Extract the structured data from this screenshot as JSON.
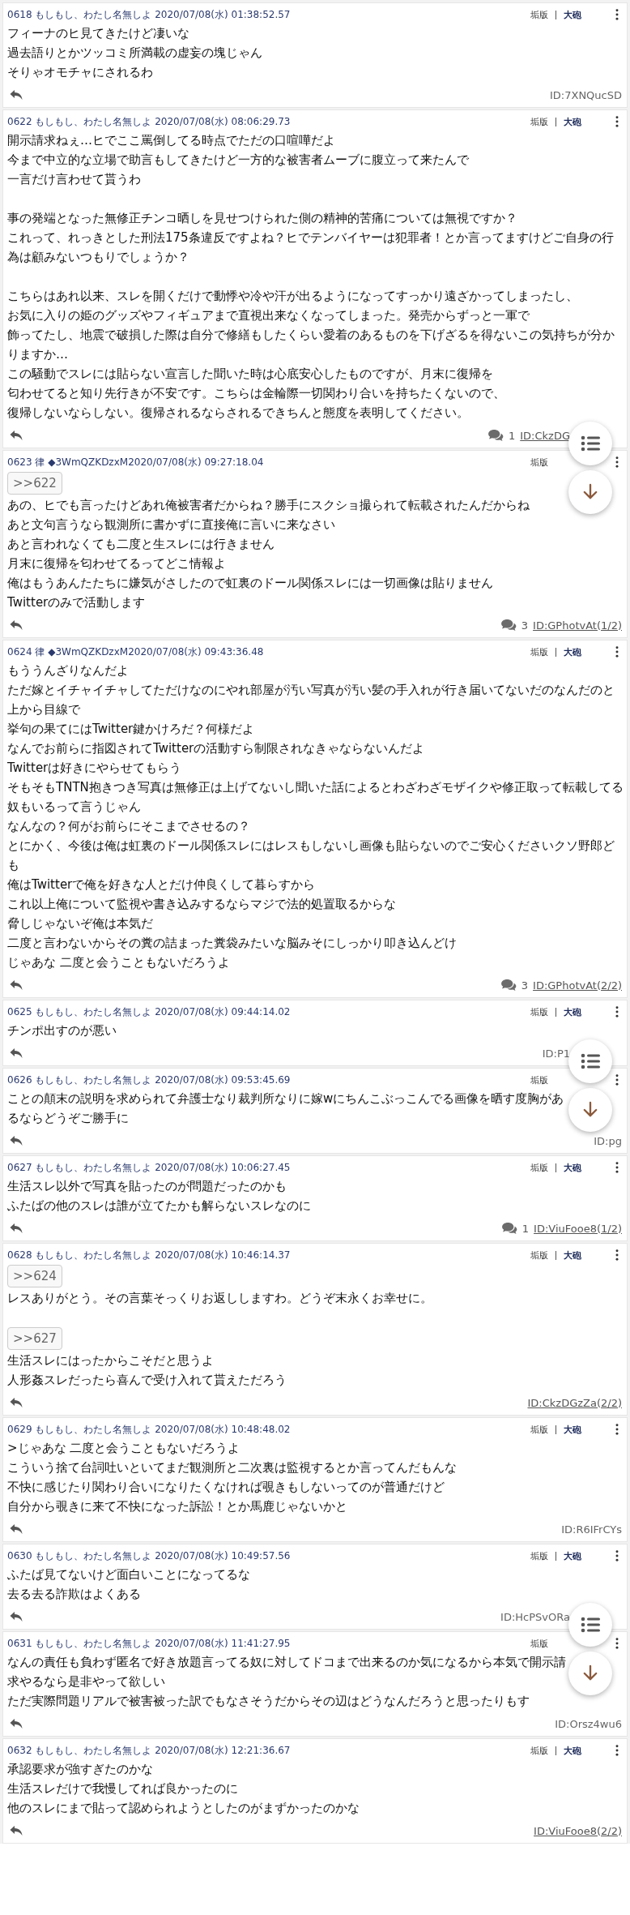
{
  "posts": [
    {
      "number": "0618",
      "name": "もしもし、わたし名無しよ",
      "date": "2020/07/08(水) 01:38:52.57",
      "actions": [
        "垢版",
        "大砲"
      ],
      "body": [
        {
          "kind": "text",
          "lines": [
            "フィーナのヒ見てきたけど凄いな",
            "過去語りとかツッコミ所満載の虚妄の塊じゃん",
            "そりゃオモチャにされるわ"
          ]
        }
      ],
      "id": "ID:7XNQucSD",
      "linked": false
    },
    {
      "number": "0622",
      "name": "もしもし、わたし名無しよ",
      "date": "2020/07/08(水) 08:06:29.73",
      "actions": [
        "垢版",
        "大砲"
      ],
      "body": [
        {
          "kind": "text",
          "lines": [
            "開示請求ねぇ…ヒでここ罵倒してる時点でただの口喧嘩だよ",
            "今まで中立的な立場で助言もしてきたけど一方的な被害者ムーブに腹立って来たんで",
            "一言だけ言わせて貰うわ"
          ]
        },
        {
          "kind": "text",
          "lines": [
            "事の発端となった無修正チンコ晒しを見せつけられた側の精神的苦痛については無視ですか？",
            "これって、れっきとした刑法175条違反ですよね？ヒでテンバイヤーは犯罪者！とか言ってますけどご自身の行為は顧みないつもりでしょうか？"
          ]
        },
        {
          "kind": "text",
          "lines": [
            "こちらはあれ以来、スレを開くだけで動悸や冷や汗が出るようになってすっかり遠ざかってしまったし、",
            "お気に入りの姫のグッズやフィギュアまで直視出来なくなってしまった。発売からずっと一軍で",
            "飾ってたし、地震で破損した際は自分で修繕もしたくらい愛着のあるものを下げざるを得ないこの気持ちが分かりますか…",
            "この騒動でスレには貼らない宣言した聞いた時は心底安心したものですが、月末に復帰を",
            "匂わせてると知り先行きが不安です。こちらは金輪際一切関わり合いを持ちたくないので、",
            "復帰しないならしない。復帰されるならされるできちんと態度を表明してください。"
          ]
        }
      ],
      "reply_count": "1",
      "id": "ID:CkzDG",
      "linked": true,
      "list_button_over": true
    },
    {
      "number": "0623",
      "name": "律",
      "trip": "◆3WmQZKDzxM",
      "date": "2020/07/08(水) 09:27:18.04",
      "actions": [
        "垢版"
      ],
      "body": [
        {
          "kind": "quote",
          "text": ">>622"
        },
        {
          "kind": "text",
          "lines": [
            "あの、ヒでも言ったけどあれ俺被害者だからね？勝手にスクショ撮られて転載されたんだからね",
            "あと文句言うなら観測所に書かずに直接俺に言いに来なさい",
            "あと言われなくても二度と生スレには行きません",
            "月末に復帰を匂わせてるってどこ情報よ",
            "俺はもうあんたたちに嫌気がさしたので虹裏のドール関係スレには一切画像は貼りません",
            "Twitterのみで活動します"
          ]
        }
      ],
      "reply_count": "3",
      "id": "ID:GPhotvAt(1/2)",
      "linked": true,
      "scroll_button_over": true
    },
    {
      "number": "0624",
      "name": "律",
      "trip": "◆3WmQZKDzxM",
      "date": "2020/07/08(水) 09:43:36.48",
      "actions": [
        "垢版",
        "大砲"
      ],
      "body": [
        {
          "kind": "text",
          "lines": [
            "もううんざりなんだよ",
            "ただ嫁とイチャイチャしてただけなのにやれ部屋が汚い写真が汚い髪の手入れが行き届いてないだのなんだのと上から目線で",
            "挙句の果てにはTwitter鍵かけろだ？何様だよ",
            "なんでお前らに指図されてTwitterの活動すら制限されなきゃならないんだよ",
            "Twitterは好きにやらせてもらう",
            "そもそもTNTN抱きつき写真は無修正は上げてないし聞いた話によるとわざわざモザイクや修正取って転載してる奴もいるって言うじゃん",
            "なんなの？何がお前らにそこまでさせるの？",
            "とにかく、今後は俺は虹裏のドール関係スレにはレスもしないし画像も貼らないのでご安心くださいクソ野郎ども",
            "俺はTwitterで俺を好きな人とだけ仲良くして暮らすから",
            "これ以上俺について監視や書き込みするならマジで法的処置取るからな",
            "脅しじゃないぞ俺は本気だ",
            "二度と言わないからその糞の詰まった糞袋みたいな脳みそにしっかり叩き込んどけ",
            "じゃあな 二度と会うこともないだろうよ"
          ]
        }
      ],
      "reply_count": "3",
      "id": "ID:GPhotvAt(2/2)",
      "linked": true
    },
    {
      "number": "0625",
      "name": "もしもし、わたし名無しよ",
      "date": "2020/07/08(水) 09:44:14.02",
      "actions": [
        "垢版",
        "大砲"
      ],
      "body": [
        {
          "kind": "text",
          "lines": [
            "チンポ出すのが悪い"
          ]
        }
      ],
      "id": "ID:P1",
      "linked": false,
      "list_button_over": true
    },
    {
      "number": "0626",
      "name": "もしもし、わたし名無しよ",
      "date": "2020/07/08(水) 09:53:45.69",
      "actions": [
        "垢版"
      ],
      "body": [
        {
          "kind": "text",
          "lines": [
            "ことの顛末の説明を求められて弁護士なり裁判所なりに嫁wにちんこぶっこんでる画像を晒す度胸があるならどうぞご勝手に"
          ]
        }
      ],
      "id": "ID:pg",
      "linked": false,
      "scroll_button_over": true
    },
    {
      "number": "0627",
      "name": "もしもし、わたし名無しよ",
      "date": "2020/07/08(水) 10:06:27.45",
      "actions": [
        "垢版",
        "大砲"
      ],
      "body": [
        {
          "kind": "text",
          "lines": [
            "生活スレ以外で写真を貼ったのが問題だったのかも",
            "ふたばの他のスレは誰が立てたかも解らないスレなのに"
          ]
        }
      ],
      "reply_count": "1",
      "id": "ID:ViuFooe8(1/2)",
      "linked": true
    },
    {
      "number": "0628",
      "name": "もしもし、わたし名無しよ",
      "date": "2020/07/08(水) 10:46:14.37",
      "actions": [
        "垢版",
        "大砲"
      ],
      "body": [
        {
          "kind": "quote",
          "text": ">>624"
        },
        {
          "kind": "text",
          "lines": [
            "レスありがとう。その言葉そっくりお返ししますわ。どうぞ末永くお幸せに。"
          ]
        },
        {
          "kind": "quote",
          "text": ">>627"
        },
        {
          "kind": "text",
          "lines": [
            "生活スレにはったからこそだと思うよ",
            "人形姦スレだったら喜んで受け入れて貰えただろう"
          ]
        }
      ],
      "id": "ID:CkzDGzZa(2/2)",
      "linked": true
    },
    {
      "number": "0629",
      "name": "もしもし、わたし名無しよ",
      "date": "2020/07/08(水) 10:48:48.02",
      "actions": [
        "垢版",
        "大砲"
      ],
      "body": [
        {
          "kind": "text",
          "lines": [
            ">じゃあな 二度と会うこともないだろうよ",
            "こういう捨て台詞吐いといてまだ観測所と二次裏は監視するとか言ってんだもんな",
            "不快に感じたり関わり合いになりたくなければ覗きもしないってのが普通だけど",
            "自分から覗きに来て不快になった訴訟！とか馬鹿じゃないかと"
          ]
        }
      ],
      "id": "ID:R6IFrCYs",
      "linked": false
    },
    {
      "number": "0630",
      "name": "もしもし、わたし名無しよ",
      "date": "2020/07/08(水) 10:49:57.56",
      "actions": [
        "垢版",
        "大砲"
      ],
      "body": [
        {
          "kind": "text",
          "lines": [
            "ふたば見てないけど面白いことになってるな",
            "去る去る詐欺はよくある"
          ]
        }
      ],
      "id": "ID:HcPSvORa",
      "linked": false,
      "list_button_over": true
    },
    {
      "number": "0631",
      "name": "もしもし、わたし名無しよ",
      "date": "2020/07/08(水) 11:41:27.95",
      "actions": [
        "垢版"
      ],
      "body": [
        {
          "kind": "text",
          "lines": [
            "なんの責任も負わず匿名で好き放題言ってる奴に対してドコまで出来るのか気になるから本気で開示請求やるなら是非やって欲しい",
            "ただ実際問題リアルで被害被った訳でもなさそうだからその辺はどうなんだろうと思ったりもす"
          ]
        }
      ],
      "id": "ID:Orsz4wu6",
      "linked": false,
      "scroll_button_over": true
    },
    {
      "number": "0632",
      "name": "もしもし、わたし名無しよ",
      "date": "2020/07/08(水) 12:21:36.67",
      "actions": [
        "垢版",
        "大砲"
      ],
      "body": [
        {
          "kind": "text",
          "lines": [
            "承認要求が強すぎたのかな",
            "生活スレだけで我慢してれば良かったのに",
            "他のスレにまで貼って認められようとしたのがまずかったのかな"
          ]
        }
      ],
      "id": "ID:ViuFooe8(2/2)",
      "linked": true
    }
  ]
}
